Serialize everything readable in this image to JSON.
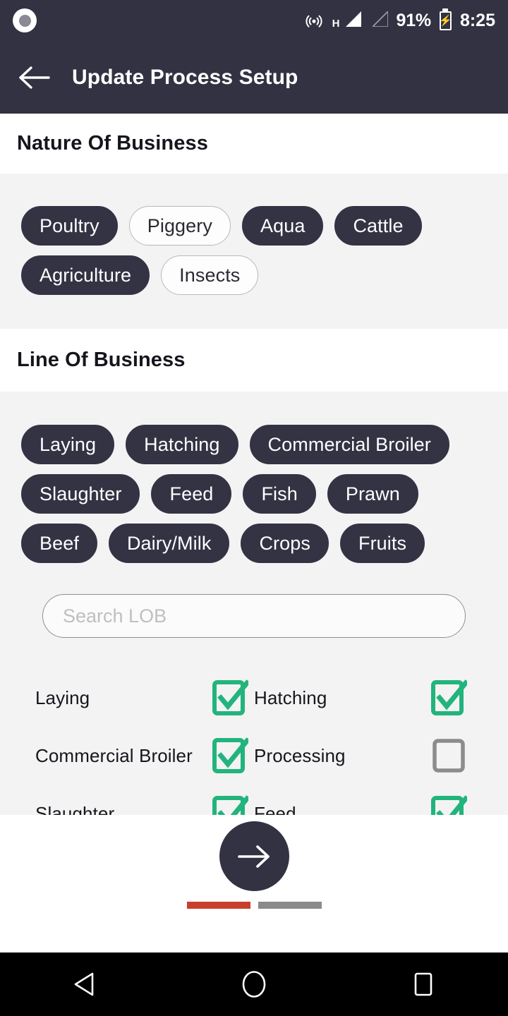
{
  "statusbar": {
    "camera_icon": "camera-dot-icon",
    "cast_icon": "hotspot-icon",
    "network_type": "H",
    "signal_icon": "signal-bars-icon",
    "signal_2_icon": "signal-bars-empty-icon",
    "battery_percent": "91%",
    "battery_icon": "battery-charging-icon",
    "time": "8:25"
  },
  "appbar": {
    "back_icon": "arrow-left-icon",
    "title": "Update Process Setup"
  },
  "nature_of_business": {
    "heading": "Nature Of Business",
    "chips": [
      {
        "label": "Poultry",
        "selected": true
      },
      {
        "label": "Piggery",
        "selected": false
      },
      {
        "label": "Aqua",
        "selected": true
      },
      {
        "label": "Cattle",
        "selected": true
      },
      {
        "label": "Agriculture",
        "selected": true
      },
      {
        "label": "Insects",
        "selected": false
      }
    ]
  },
  "line_of_business": {
    "heading": "Line Of Business",
    "chips": [
      {
        "label": "Laying",
        "selected": true
      },
      {
        "label": "Hatching",
        "selected": true
      },
      {
        "label": "Commercial Broiler",
        "selected": true
      },
      {
        "label": "Slaughter",
        "selected": true
      },
      {
        "label": "Feed",
        "selected": true
      },
      {
        "label": "Fish",
        "selected": true
      },
      {
        "label": "Prawn",
        "selected": true
      },
      {
        "label": "Beef",
        "selected": true
      },
      {
        "label": "Dairy/Milk",
        "selected": true
      },
      {
        "label": "Crops",
        "selected": true
      },
      {
        "label": "Fruits",
        "selected": true
      }
    ],
    "search": {
      "placeholder": "Search LOB",
      "value": ""
    },
    "checkbox_rows": [
      [
        {
          "label": "Laying",
          "checked": true
        },
        {
          "label": "Hatching",
          "checked": true
        }
      ],
      [
        {
          "label": "Commercial Broiler",
          "checked": true
        },
        {
          "label": "Processing",
          "checked": false
        }
      ],
      [
        {
          "label": "Slaughter",
          "checked": true
        },
        {
          "label": "Feed",
          "checked": true
        }
      ]
    ]
  },
  "bottom": {
    "next_icon": "arrow-right-icon",
    "page_indicators": [
      {
        "name": "step-1",
        "active": true
      },
      {
        "name": "step-2",
        "active": false
      }
    ]
  },
  "navbar": {
    "back_icon": "nav-back-triangle-icon",
    "home_icon": "nav-home-circle-icon",
    "recents_icon": "nav-recents-square-icon"
  },
  "colors": {
    "dark": "#323243",
    "chip_dark": "#333344",
    "section_bg": "#f3f3f4",
    "checkbox_green": "#22b47c",
    "checkbox_gray": "#8c8c8c",
    "indicator_active": "#c8402d",
    "indicator_inactive": "#8b8b8b",
    "navbar": "#000000"
  }
}
